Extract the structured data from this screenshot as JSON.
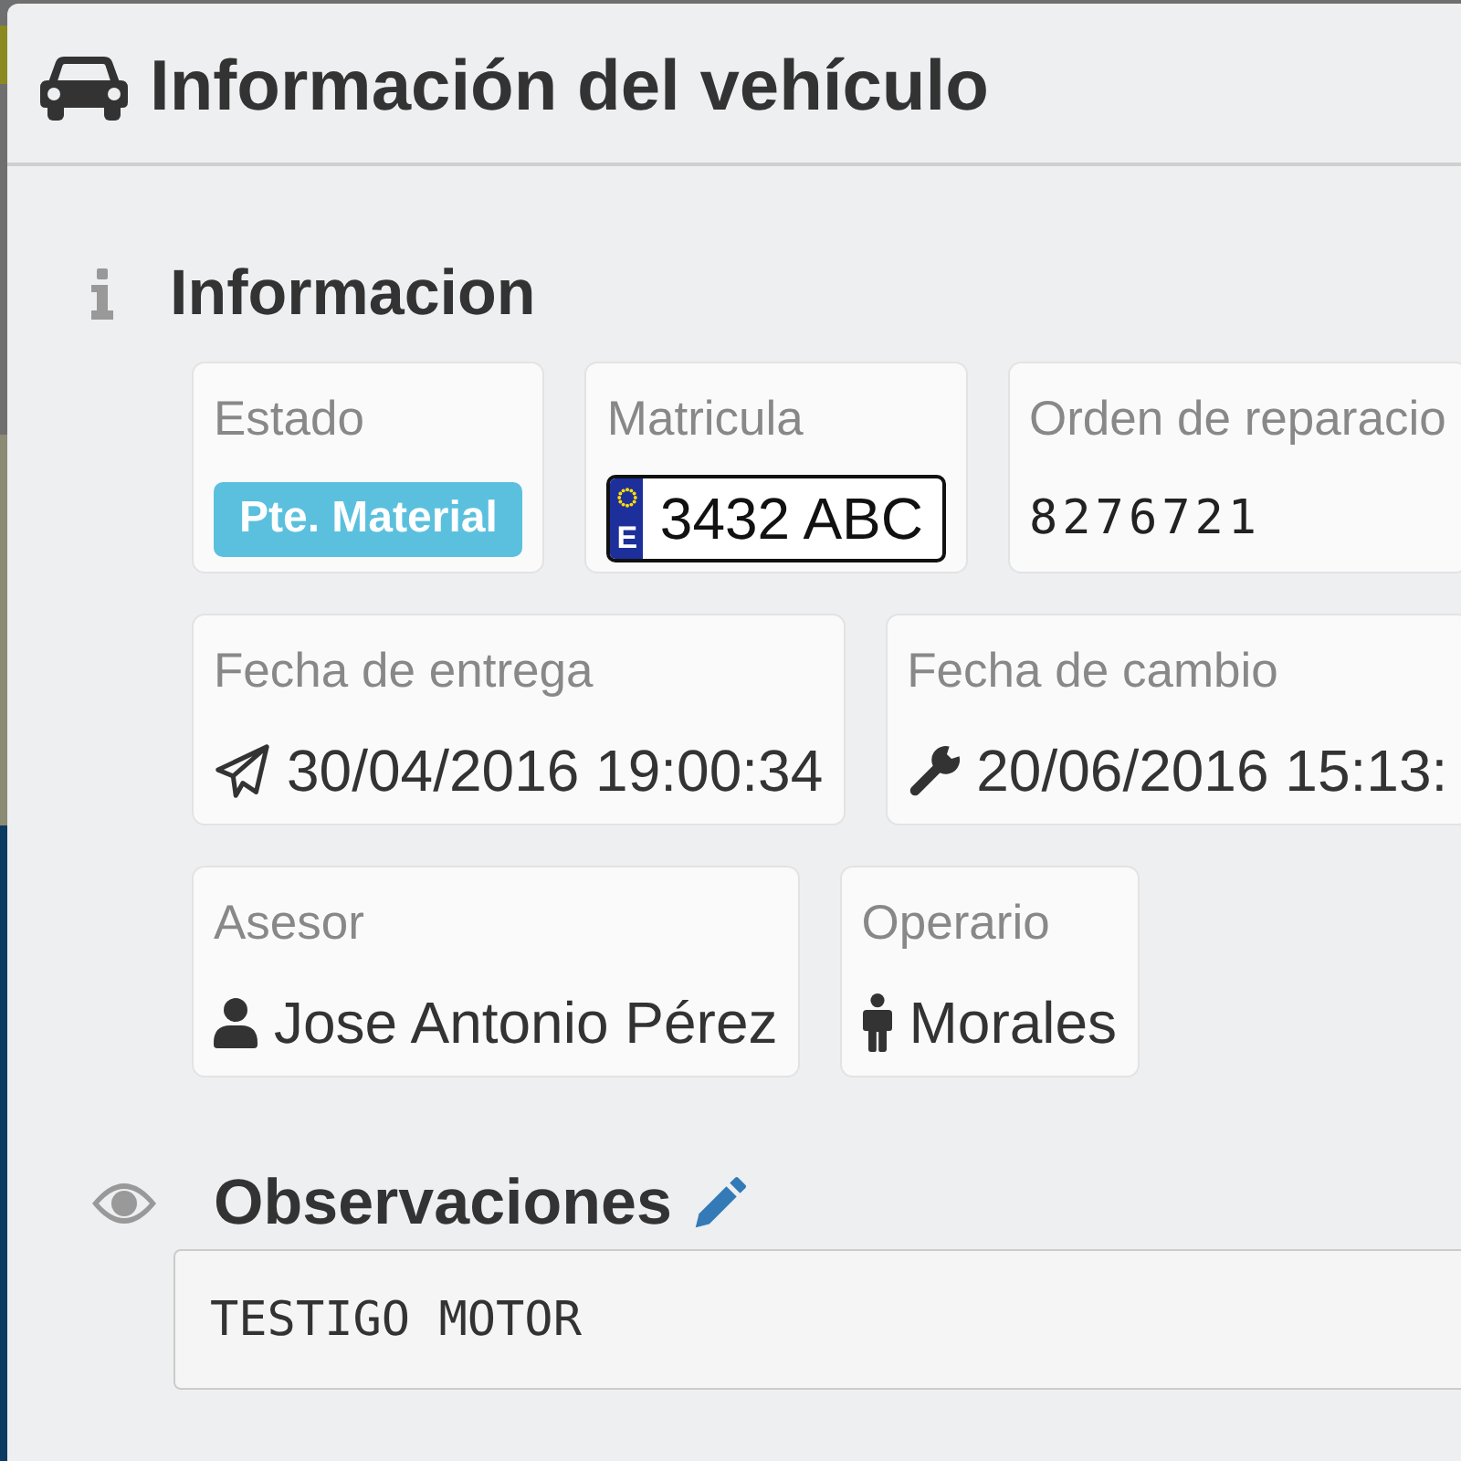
{
  "modal": {
    "title": "Información del vehículo"
  },
  "info_section": {
    "title": "Informacion",
    "rows": [
      {
        "fields": [
          {
            "kind": "badge",
            "label": "Estado",
            "value": "Pte. Material"
          },
          {
            "kind": "plate",
            "label": "Matricula",
            "country": "E",
            "value": "3432 ABC"
          },
          {
            "kind": "code",
            "label": "Orden de reparacio",
            "value": "8276721"
          }
        ]
      },
      {
        "fields": [
          {
            "kind": "sent",
            "label": "Fecha de entrega",
            "value": "30/04/2016 19:00:34"
          },
          {
            "kind": "changed",
            "label": "Fecha de cambio",
            "value": "20/06/2016 15:13:"
          }
        ]
      },
      {
        "fields": [
          {
            "kind": "advisor",
            "label": "Asesor",
            "value": "Jose Antonio Pérez"
          },
          {
            "kind": "worker",
            "label": "Operario",
            "value": "Morales"
          }
        ]
      }
    ]
  },
  "observations": {
    "title": "Observaciones",
    "value": "TESTIGO MOTOR"
  }
}
